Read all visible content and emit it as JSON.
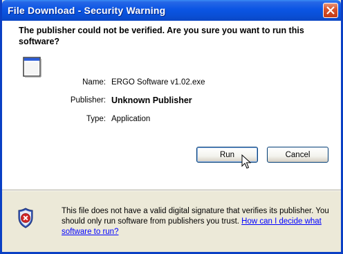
{
  "window": {
    "title": "File Download - Security Warning"
  },
  "headline": "The publisher could not be verified.  Are you sure you want to run this software?",
  "details": {
    "name_label": "Name:",
    "name_value": "ERGO Software v1.02.exe",
    "publisher_label": "Publisher:",
    "publisher_value": "Unknown Publisher",
    "type_label": "Type:",
    "type_value": "Application"
  },
  "buttons": {
    "run": "Run",
    "cancel": "Cancel"
  },
  "warning": {
    "text": "This file does not have a valid digital signature that verifies its publisher. You should only run software from publishers you trust.  ",
    "link": "How can I decide what software to run?"
  },
  "icons": {
    "close": "close-icon",
    "app": "application-window-icon",
    "shield": "security-shield-icon",
    "cursor": "mouse-cursor-icon"
  },
  "colors": {
    "titlebar": "#0b55e4",
    "close": "#d9542c",
    "link": "#0000ff"
  }
}
